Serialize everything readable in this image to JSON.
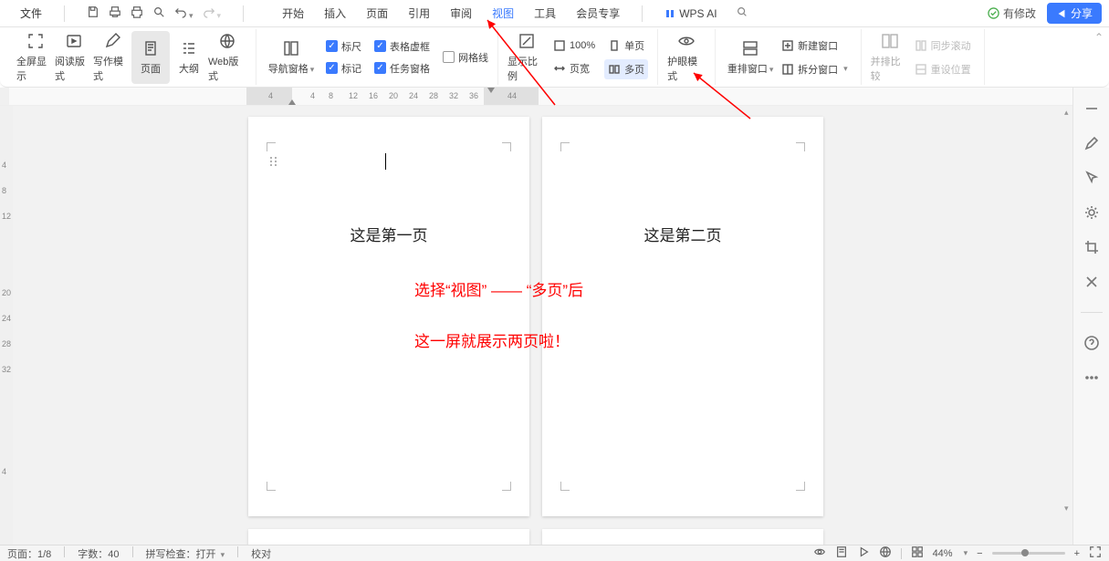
{
  "menubar": {
    "file": "文件",
    "tabs": [
      "开始",
      "插入",
      "页面",
      "引用",
      "审阅",
      "视图",
      "工具",
      "会员专享"
    ],
    "active_tab_index": 5,
    "ai_label": "WPS AI",
    "modified_label": "有修改",
    "share_label": "分享"
  },
  "ribbon": {
    "view_modes": {
      "fullscreen": "全屏显示",
      "reading": "阅读版式",
      "writing": "写作模式",
      "page": "页面",
      "outline": "大纲",
      "web": "Web版式"
    },
    "nav_pane": "导航窗格",
    "checks": {
      "ruler": "标尺",
      "mark": "标记",
      "table_dashed": "表格虚框",
      "task_pane": "任务窗格",
      "gridlines": "网格线"
    },
    "zoom": {
      "show_ratio": "显示比例",
      "p100": "100%",
      "page_width": "页宽",
      "single_page": "单页",
      "multi_page": "多页"
    },
    "eye_mode": "护眼模式",
    "rearrange": "重排窗口",
    "new_window": "新建窗口",
    "split_window": "拆分窗口",
    "side_compare": "并排比较",
    "sync_scroll": "同步滚动",
    "reset_position": "重设位置"
  },
  "ruler": {
    "ticks": [
      "4",
      "4",
      "8",
      "12",
      "16",
      "20",
      "24",
      "28",
      "32",
      "36",
      "44"
    ]
  },
  "vruler": {
    "ticks": [
      "4",
      "8",
      "12",
      "20",
      "24",
      "28",
      "32",
      "4"
    ]
  },
  "pages": {
    "p1": "这是第一页",
    "p2": "这是第二页"
  },
  "annotations": {
    "line1": "选择“视图” —— “多页”后",
    "line2": "这一屏就展示两页啦！"
  },
  "statusbar": {
    "page": "页面：1/8",
    "words": "字数：40",
    "spellcheck": "拼写检查：打开",
    "proofread": "校对",
    "zoom": "44%"
  }
}
